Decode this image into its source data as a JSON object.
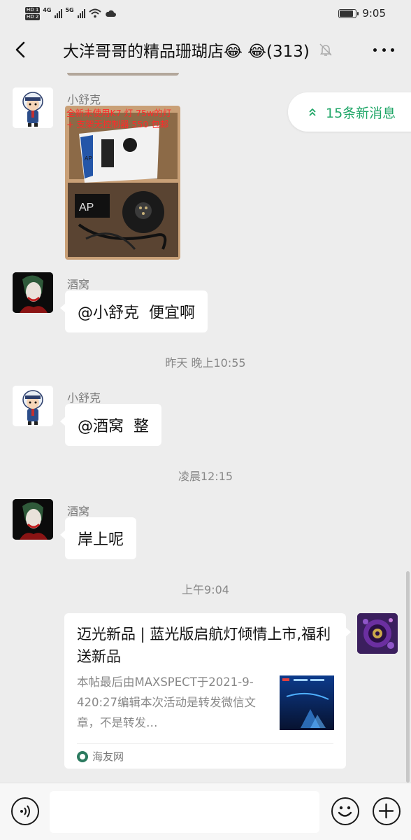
{
  "status_bar": {
    "hd_badges": [
      "HD 1",
      "HD 2"
    ],
    "network_1": "4G",
    "network_2": "5G",
    "time": "9:05",
    "battery_level": 0.85
  },
  "header": {
    "title": "大洋哥哥的精品珊瑚店😂 😂(313)",
    "back_icon": "chevron-left-icon",
    "mute_icon": "bell-muted-icon",
    "more_icon": "more-dots-icon"
  },
  "new_messages_pill": {
    "label": "15条新消息",
    "icon": "double-chevron-up-icon",
    "color": "#1fa667"
  },
  "messages": [
    {
      "sender": "小舒克",
      "type": "image",
      "image_caption": "全新未使用K7 灯 75w的灯 + 支架无控制器 550 包邮"
    },
    {
      "sender": "酒窝",
      "type": "text",
      "text": "@小舒克  便宜啊"
    },
    {
      "type": "timestamp",
      "text": "昨天 晚上10:55"
    },
    {
      "sender": "小舒克",
      "type": "text",
      "text": "@酒窝  整"
    },
    {
      "type": "timestamp",
      "text": "凌晨12:15"
    },
    {
      "sender": "酒窝",
      "type": "text",
      "text": "岸上呢"
    },
    {
      "type": "timestamp",
      "text": "上午9:04"
    },
    {
      "type": "link_card",
      "title": "迈光新品 | 蓝光版启航灯倾情上市,福利送新品",
      "description": "本帖最后由MAXSPECT于2021-9-420:27编辑本次活动是转发微信文章，不是转发…",
      "source": "海友网"
    }
  ],
  "input_bar": {
    "placeholder": "",
    "voice_icon": "voice-icon",
    "emoji_icon": "emoji-icon",
    "plus_icon": "plus-circle-icon"
  },
  "colors": {
    "background": "#ededed",
    "bubble": "#ffffff",
    "accent_green": "#1fa667",
    "caption_red": "#ff2a2a"
  }
}
